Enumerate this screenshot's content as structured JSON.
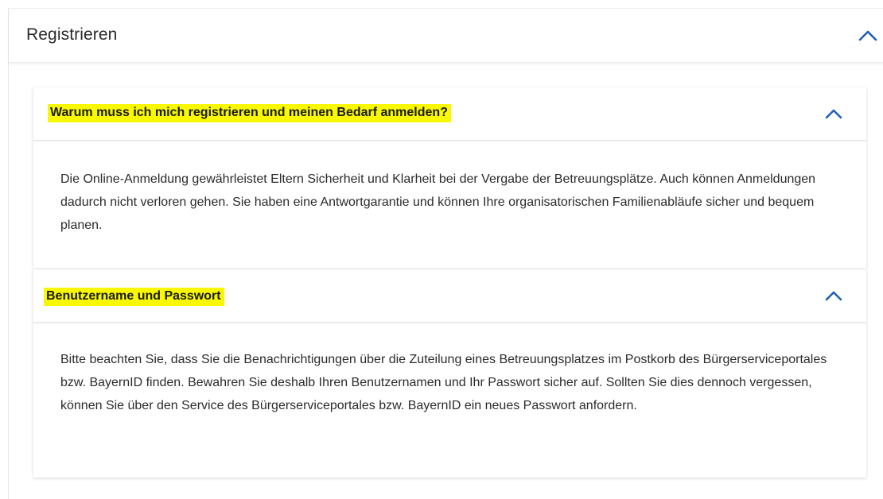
{
  "section": {
    "title": "Registrieren"
  },
  "faq": [
    {
      "question": "Warum muss ich mich registrieren und meinen Bedarf anmelden?",
      "answer": "Die Online-Anmeldung gewährleistet Eltern Sicherheit und Klarheit bei der Vergabe der Betreuungsplätze. Auch können Anmeldungen dadurch nicht verloren gehen. Sie haben eine Antwortgarantie und können Ihre organisatorischen Familienabläufe sicher und bequem planen."
    },
    {
      "question": "Benutzername und Passwort",
      "answer": "Bitte beachten Sie, dass Sie die Benachrichtigungen über die Zuteilung eines Betreuungsplatzes im Postkorb des Bürgerserviceportales bzw. BayernID finden. Bewahren Sie deshalb Ihren Benutzernamen und Ihr Passwort sicher auf. Sollten Sie dies dennoch vergessen, können Sie über den Service des Bürgerserviceportales bzw. BayernID ein neues Passwort anfordern."
    }
  ],
  "icons": {
    "collapse": "chevron-up-icon"
  },
  "colors": {
    "accent": "#1f5fb4",
    "highlight": "#f8f800"
  }
}
